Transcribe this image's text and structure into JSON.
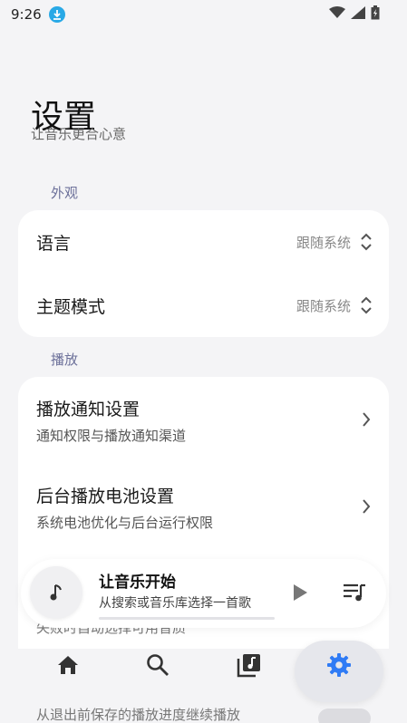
{
  "status_bar": {
    "time": "9:26"
  },
  "header": {
    "title": "设置",
    "subtitle": "让音乐更合心意"
  },
  "sections": {
    "appearance": {
      "title": "外观",
      "items": [
        {
          "label": "语言",
          "value": "跟随系统"
        },
        {
          "label": "主题模式",
          "value": "跟随系统"
        }
      ]
    },
    "playback": {
      "title": "播放",
      "items": [
        {
          "label": "播放通知设置",
          "sub": "通知权限与播放通知渠道"
        },
        {
          "label": "后台播放电池设置",
          "sub": "系统电池优化与后台运行权限"
        }
      ],
      "hidden_1": "失败时自动选择可用音质",
      "hidden_2": "从退出前保存的播放进度继续播放"
    }
  },
  "player": {
    "title": "让音乐开始",
    "subtitle": "从搜索或音乐库选择一首歌"
  },
  "nav": {
    "items": [
      {
        "name": "home-icon"
      },
      {
        "name": "search-icon"
      },
      {
        "name": "library-icon"
      },
      {
        "name": "settings-icon"
      }
    ],
    "active": 3,
    "active_color": "#2f7bf5"
  }
}
